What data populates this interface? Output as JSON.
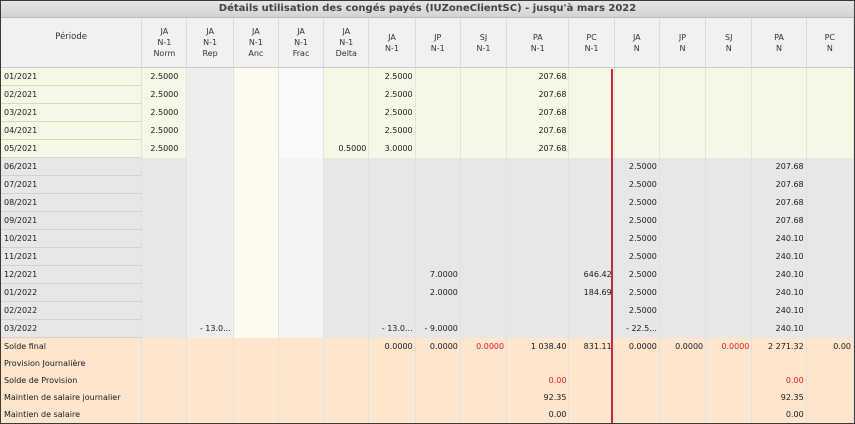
{
  "window": {
    "title": "Détails utilisation des congés payés (IUZoneClientSC) - jusqu'à mars 2022"
  },
  "columns": [
    {
      "key": "periode",
      "line1": "Période",
      "line2": "",
      "line3": ""
    },
    {
      "key": "ja_norm",
      "line1": "JA",
      "line2": "N-1",
      "line3": "Norm"
    },
    {
      "key": "ja_rep",
      "line1": "JA",
      "line2": "N-1",
      "line3": "Rep"
    },
    {
      "key": "ja_anc",
      "line1": "JA",
      "line2": "N-1",
      "line3": "Anc"
    },
    {
      "key": "ja_frac",
      "line1": "JA",
      "line2": "N-1",
      "line3": "Frac"
    },
    {
      "key": "ja_delta",
      "line1": "JA",
      "line2": "N-1",
      "line3": "Delta"
    },
    {
      "key": "ja_n1",
      "line1": "JA",
      "line2": "N-1",
      "line3": ""
    },
    {
      "key": "jp_n1",
      "line1": "JP",
      "line2": "N-1",
      "line3": ""
    },
    {
      "key": "sj_n1",
      "line1": "SJ",
      "line2": "N-1",
      "line3": ""
    },
    {
      "key": "pa_n1",
      "line1": "PA",
      "line2": "N-1",
      "line3": ""
    },
    {
      "key": "pc_n1",
      "line1": "PC",
      "line2": "N-1",
      "line3": ""
    },
    {
      "key": "ja_n",
      "line1": "JA",
      "line2": "N",
      "line3": ""
    },
    {
      "key": "jp_n",
      "line1": "JP",
      "line2": "N",
      "line3": ""
    },
    {
      "key": "sj_n",
      "line1": "SJ",
      "line2": "N",
      "line3": ""
    },
    {
      "key": "pa_n",
      "line1": "PA",
      "line2": "N",
      "line3": ""
    },
    {
      "key": "pc_n",
      "line1": "PC",
      "line2": "N",
      "line3": ""
    }
  ],
  "rows": [
    {
      "group": "g1",
      "cells": [
        "01/2021",
        "2.5000",
        "",
        "",
        "",
        "",
        "2.5000",
        "",
        "",
        "207.68",
        "",
        "",
        "",
        "",
        "",
        ""
      ]
    },
    {
      "group": "g1",
      "cells": [
        "02/2021",
        "2.5000",
        "",
        "",
        "",
        "",
        "2.5000",
        "",
        "",
        "207.68",
        "",
        "",
        "",
        "",
        "",
        ""
      ]
    },
    {
      "group": "g1",
      "cells": [
        "03/2021",
        "2.5000",
        "",
        "",
        "",
        "",
        "2.5000",
        "",
        "",
        "207.68",
        "",
        "",
        "",
        "",
        "",
        ""
      ]
    },
    {
      "group": "g1",
      "cells": [
        "04/2021",
        "2.5000",
        "",
        "",
        "",
        "",
        "2.5000",
        "",
        "",
        "207.68",
        "",
        "",
        "",
        "",
        "",
        ""
      ]
    },
    {
      "group": "g1",
      "cells": [
        "05/2021",
        "2.5000",
        "",
        "",
        "",
        "0.5000",
        "3.0000",
        "",
        "",
        "207.68",
        "",
        "",
        "",
        "",
        "",
        ""
      ]
    },
    {
      "group": "g2",
      "cells": [
        "06/2021",
        "",
        "",
        "",
        "",
        "",
        "",
        "",
        "",
        "",
        "",
        "2.5000",
        "",
        "",
        "207.68",
        ""
      ]
    },
    {
      "group": "g2",
      "cells": [
        "07/2021",
        "",
        "",
        "",
        "",
        "",
        "",
        "",
        "",
        "",
        "",
        "2.5000",
        "",
        "",
        "207.68",
        ""
      ]
    },
    {
      "group": "g2",
      "cells": [
        "08/2021",
        "",
        "",
        "",
        "",
        "",
        "",
        "",
        "",
        "",
        "",
        "2.5000",
        "",
        "",
        "207.68",
        ""
      ]
    },
    {
      "group": "g2",
      "cells": [
        "09/2021",
        "",
        "",
        "",
        "",
        "",
        "",
        "",
        "",
        "",
        "",
        "2.5000",
        "",
        "",
        "207.68",
        ""
      ]
    },
    {
      "group": "g2",
      "cells": [
        "10/2021",
        "",
        "",
        "",
        "",
        "",
        "",
        "",
        "",
        "",
        "",
        "2.5000",
        "",
        "",
        "240.10",
        ""
      ]
    },
    {
      "group": "g2",
      "cells": [
        "11/2021",
        "",
        "",
        "",
        "",
        "",
        "",
        "",
        "",
        "",
        "",
        "2.5000",
        "",
        "",
        "240.10",
        ""
      ]
    },
    {
      "group": "g2",
      "cells": [
        "12/2021",
        "",
        "",
        "",
        "",
        "",
        "",
        "7.0000",
        "",
        "",
        "646.42",
        "2.5000",
        "",
        "",
        "240.10",
        ""
      ]
    },
    {
      "group": "g2",
      "cells": [
        "01/2022",
        "",
        "",
        "",
        "",
        "",
        "",
        "2.0000",
        "",
        "",
        "184.69",
        "2.5000",
        "",
        "",
        "240.10",
        ""
      ]
    },
    {
      "group": "g2",
      "cells": [
        "02/2022",
        "",
        "",
        "",
        "",
        "",
        "",
        "",
        "",
        "",
        "",
        "2.5000",
        "",
        "",
        "240.10",
        ""
      ]
    },
    {
      "group": "g2",
      "cells": [
        "03/2022",
        "",
        "- 13.0...",
        "",
        "",
        "",
        "- 13.0...",
        "- 9.0000",
        "",
        "",
        "",
        "- 22.5...",
        "",
        "",
        "240.10",
        ""
      ]
    },
    {
      "group": "g3",
      "cells": [
        "Solde final",
        "",
        "",
        "",
        "",
        "",
        "0.0000",
        "0.0000",
        "0.0000",
        "1 038.40",
        "831.11",
        "0.0000",
        "0.0000",
        "0.0000",
        "2 271.32",
        "0.00"
      ]
    },
    {
      "group": "g3",
      "cells": [
        "Provision Journalière",
        "",
        "",
        "",
        "",
        "",
        "",
        "",
        "",
        "",
        "",
        "",
        "",
        "",
        "",
        ""
      ]
    },
    {
      "group": "g3",
      "cells": [
        "Solde de Provision",
        "",
        "",
        "",
        "",
        "",
        "",
        "",
        "",
        "0.00",
        "",
        "",
        "",
        "",
        "0.00",
        ""
      ]
    },
    {
      "group": "g3",
      "cells": [
        "Maintien de salaire journalier",
        "",
        "",
        "",
        "",
        "",
        "",
        "",
        "",
        "92.35",
        "",
        "",
        "",
        "",
        "92.35",
        ""
      ]
    },
    {
      "group": "g3",
      "cells": [
        "Maintien de salaire",
        "",
        "",
        "",
        "",
        "",
        "",
        "",
        "",
        "0.00",
        "",
        "",
        "",
        "",
        "0.00",
        ""
      ]
    }
  ],
  "red_cells": [
    [
      15,
      8
    ],
    [
      15,
      13
    ],
    [
      17,
      9
    ],
    [
      17,
      14
    ]
  ],
  "colors": {
    "separator_line": "#c8283a",
    "negative_or_flag": "#e21d1d"
  }
}
